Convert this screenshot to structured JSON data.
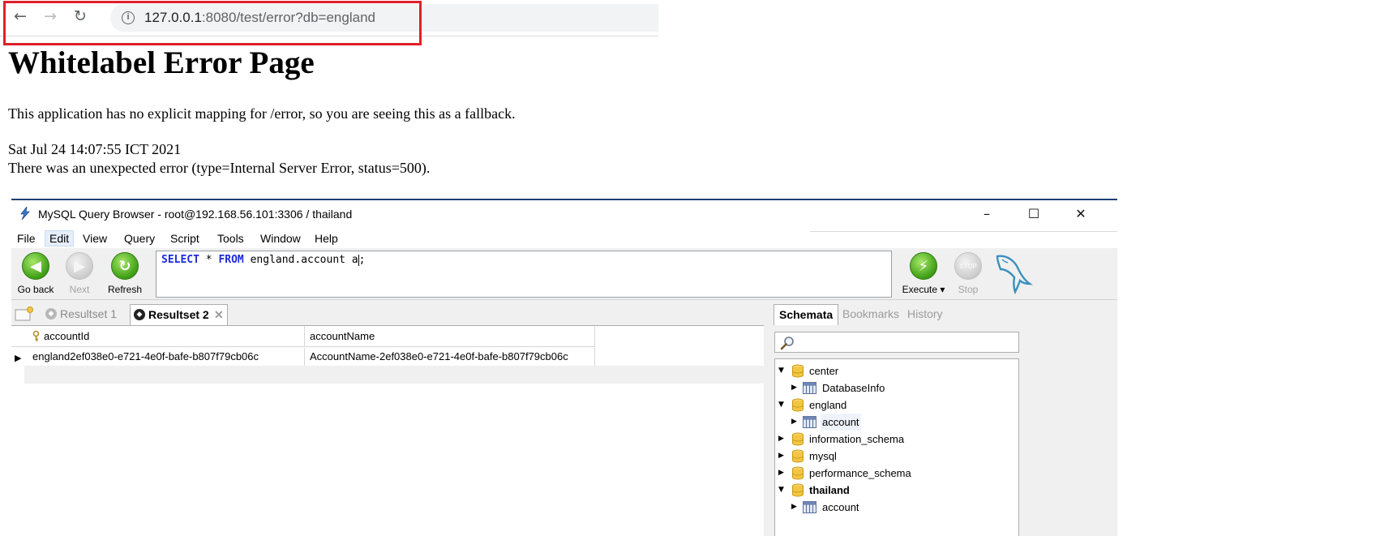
{
  "browser": {
    "url_host": "127.0.0.1",
    "url_rest": ":8080/test/error?db=england",
    "info_glyph": "i",
    "back_glyph": "←",
    "forward_glyph": "→",
    "reload_glyph": "↻"
  },
  "error_page": {
    "title": "Whitelabel Error Page",
    "message": "This application has no explicit mapping for /error, so you are seeing this as a fallback.",
    "timestamp": "Sat Jul 24 14:07:55 ICT 2021",
    "details": "There was an unexpected error (type=Internal Server Error, status=500)."
  },
  "query_browser": {
    "window_title": "MySQL Query Browser - root@192.168.56.101:3306 / thailand",
    "window_controls": {
      "minimize": "–",
      "maximize": "☐",
      "close": "✕"
    },
    "menu": [
      "File",
      "Edit",
      "View",
      "Query",
      "Script",
      "Tools",
      "Window",
      "Help"
    ],
    "active_menu": "Edit",
    "toolbar": {
      "go_back": "Go back",
      "next": "Next",
      "refresh": "Refresh",
      "execute": "Execute ▾",
      "stop": "Stop",
      "stop_badge": "STOP"
    },
    "query": {
      "kw_select": "SELECT",
      "star": " * ",
      "kw_from": "FROM",
      "rest": " england.account a",
      "tail": ";"
    },
    "resultset_tabs": [
      {
        "label": "Resultset 1",
        "active": false
      },
      {
        "label": "Resultset 2",
        "active": true
      }
    ],
    "tab_close_glyph": "✕",
    "grid": {
      "columns": [
        "accountId",
        "accountName"
      ],
      "rows": [
        {
          "accountId": "england2ef038e0-e721-4e0f-bafe-b807f79cb06c",
          "accountName": "AccountName-2ef038e0-e721-4e0f-bafe-b807f79cb06c"
        }
      ],
      "row_marker": "▶"
    },
    "side_tabs": [
      "Schemata",
      "Bookmarks",
      "History"
    ],
    "schemata": [
      {
        "label": "center",
        "type": "database",
        "expanded": true
      },
      {
        "label": "DatabaseInfo",
        "type": "table",
        "expanded": false
      },
      {
        "label": "england",
        "type": "database",
        "expanded": true
      },
      {
        "label": "account",
        "type": "table",
        "expanded": false
      },
      {
        "label": "information_schema",
        "type": "database",
        "expanded": false
      },
      {
        "label": "mysql",
        "type": "database",
        "expanded": false
      },
      {
        "label": "performance_schema",
        "type": "database",
        "expanded": false
      },
      {
        "label": "thailand",
        "type": "database",
        "expanded": true,
        "bold": true
      },
      {
        "label": "account",
        "type": "table",
        "expanded": false
      }
    ],
    "tree_glyph_expanded": "▼",
    "tree_glyph_collapsed": "▶"
  }
}
